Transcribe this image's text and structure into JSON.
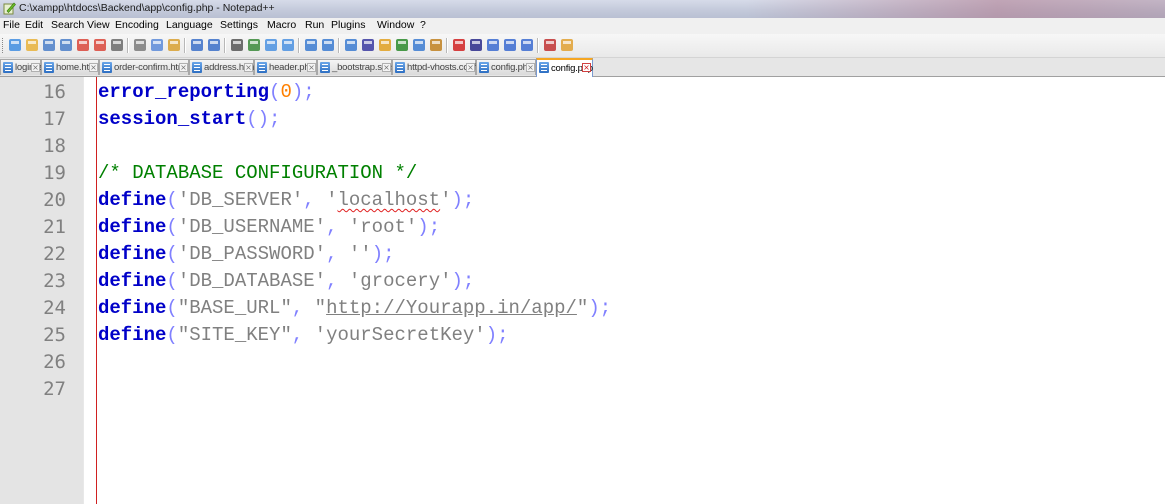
{
  "window": {
    "title": "C:\\xampp\\htdocs\\Backend\\app\\config.php - Notepad++"
  },
  "menu": [
    "File",
    "Edit",
    "Search",
    "View",
    "Encoding",
    "Language",
    "Settings",
    "Macro",
    "Run",
    "Plugins",
    "Window",
    "?"
  ],
  "toolbar_icons": [
    "new-file-icon",
    "open-file-icon",
    "save-icon",
    "save-all-icon",
    "close-icon",
    "close-all-icon",
    "print-icon",
    "cut-icon",
    "copy-icon",
    "paste-icon",
    "undo-icon",
    "redo-icon",
    "find-icon",
    "replace-icon",
    "zoom-in-icon",
    "zoom-out-icon",
    "sync-vertical-icon",
    "sync-horizontal-icon",
    "word-wrap-icon",
    "show-all-chars-icon",
    "indent-guide-icon",
    "doc-map-icon",
    "function-list-icon",
    "folder-workspace-icon",
    "record-macro-icon",
    "stop-macro-icon",
    "play-macro-icon",
    "run-macro-multiple-icon",
    "save-macro-icon",
    "spell-check-icon",
    "plugin-icon"
  ],
  "tabs": [
    {
      "label": "login.ts",
      "active": false
    },
    {
      "label": "home.html",
      "active": false
    },
    {
      "label": "order-confirm.html",
      "active": false
    },
    {
      "label": "address.html",
      "active": false
    },
    {
      "label": "header.php",
      "active": false
    },
    {
      "label": "_bootstrap.scss",
      "active": false
    },
    {
      "label": "httpd-vhosts.conf",
      "active": false
    },
    {
      "label": "config.php",
      "active": false
    },
    {
      "label": "config.php",
      "active": true
    }
  ],
  "close_glyph": "×",
  "editor": {
    "line_numbers": [
      "16",
      "17",
      "18",
      "19",
      "20",
      "21",
      "22",
      "23",
      "24",
      "25",
      "26",
      "27"
    ],
    "lines": [
      {
        "tokens": [
          {
            "t": "error_reporting",
            "c": "kw"
          },
          {
            "t": "(",
            "c": "pn"
          },
          {
            "t": "0",
            "c": "num"
          },
          {
            "t": ");",
            "c": "pn"
          }
        ]
      },
      {
        "tokens": [
          {
            "t": "session_start",
            "c": "kw"
          },
          {
            "t": "();",
            "c": "pn"
          }
        ]
      },
      {
        "tokens": []
      },
      {
        "tokens": [
          {
            "t": "/* DATABASE CONFIGURATION */",
            "c": "cm"
          }
        ]
      },
      {
        "tokens": [
          {
            "t": "define",
            "c": "kw"
          },
          {
            "t": "(",
            "c": "pn"
          },
          {
            "t": "'DB_SERVER'",
            "c": "str"
          },
          {
            "t": ", ",
            "c": "pn"
          },
          {
            "t": "'",
            "c": "str"
          },
          {
            "t": "localhost",
            "c": "str sq"
          },
          {
            "t": "'",
            "c": "str"
          },
          {
            "t": ");",
            "c": "pn"
          }
        ]
      },
      {
        "tokens": [
          {
            "t": "define",
            "c": "kw"
          },
          {
            "t": "(",
            "c": "pn"
          },
          {
            "t": "'DB_USERNAME'",
            "c": "str"
          },
          {
            "t": ", ",
            "c": "pn"
          },
          {
            "t": "'root'",
            "c": "str"
          },
          {
            "t": ");",
            "c": "pn"
          }
        ]
      },
      {
        "tokens": [
          {
            "t": "define",
            "c": "kw"
          },
          {
            "t": "(",
            "c": "pn"
          },
          {
            "t": "'DB_PASSWORD'",
            "c": "str"
          },
          {
            "t": ", ",
            "c": "pn"
          },
          {
            "t": "''",
            "c": "str"
          },
          {
            "t": ");",
            "c": "pn"
          }
        ]
      },
      {
        "tokens": [
          {
            "t": "define",
            "c": "kw"
          },
          {
            "t": "(",
            "c": "pn"
          },
          {
            "t": "'DB_DATABASE'",
            "c": "str"
          },
          {
            "t": ", ",
            "c": "pn"
          },
          {
            "t": "'grocery'",
            "c": "str"
          },
          {
            "t": ");",
            "c": "pn"
          }
        ]
      },
      {
        "tokens": [
          {
            "t": "define",
            "c": "kw"
          },
          {
            "t": "(",
            "c": "pn"
          },
          {
            "t": "\"BASE_URL\"",
            "c": "str"
          },
          {
            "t": ", ",
            "c": "pn"
          },
          {
            "t": "\"",
            "c": "str"
          },
          {
            "t": "http://Yourapp.in/app/",
            "c": "str ul"
          },
          {
            "t": "\"",
            "c": "str"
          },
          {
            "t": ");",
            "c": "pn"
          }
        ]
      },
      {
        "tokens": [
          {
            "t": "define",
            "c": "kw"
          },
          {
            "t": "(",
            "c": "pn"
          },
          {
            "t": "\"SITE_KEY\"",
            "c": "str"
          },
          {
            "t": ", ",
            "c": "pn"
          },
          {
            "t": "'yourSecretKey'",
            "c": "str"
          },
          {
            "t": ");",
            "c": "pn"
          }
        ]
      },
      {
        "tokens": []
      },
      {
        "tokens": []
      }
    ]
  },
  "colors": {
    "keyword": "#0000c8",
    "operator": "#8080ff",
    "number": "#ff8000",
    "string": "#808080",
    "comment": "#008000",
    "gutter": "#e4e4e4",
    "caret_line": "#d02020"
  }
}
